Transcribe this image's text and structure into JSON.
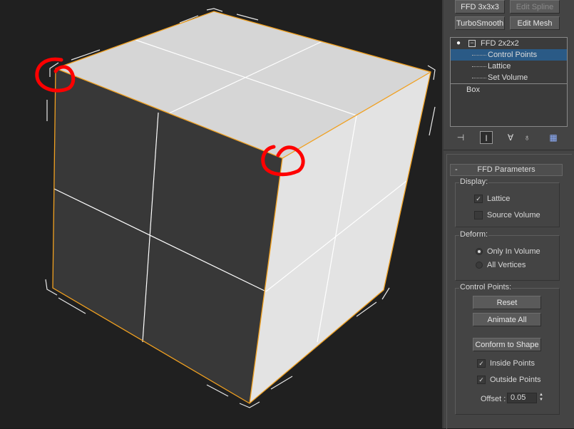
{
  "modifier_buttons": {
    "ffd333": "FFD 3x3x3",
    "edit_spline": "Edit Spline",
    "turbosmooth": "TurboSmooth",
    "edit_mesh": "Edit Mesh"
  },
  "modifier_stack": {
    "root": "FFD 2x2x2",
    "children": [
      "Control Points",
      "Lattice",
      "Set Volume"
    ],
    "base": "Box",
    "selected": "Control Points"
  },
  "rollout": {
    "collapse_symbol": "-",
    "title": "FFD Parameters",
    "display": {
      "label": "Display:",
      "lattice": {
        "label": "Lattice",
        "checked": true
      },
      "source_volume": {
        "label": "Source Volume",
        "checked": false
      }
    },
    "deform": {
      "label": "Deform:",
      "options": [
        "Only In Volume",
        "All Vertices"
      ],
      "selected": "Only In Volume"
    },
    "control_points": {
      "label": "Control Points:",
      "reset": "Reset",
      "animate_all": "Animate All",
      "conform": "Conform to Shape",
      "inside_points": {
        "label": "Inside Points",
        "checked": true
      },
      "outside_points": {
        "label": "Outside Points",
        "checked": true
      },
      "offset_label": "Offset :",
      "offset_value": "0.05"
    }
  },
  "colors": {
    "viewport_bg": "#202020",
    "selection_orange": "#f0a020",
    "annotation_red": "#ff0000",
    "stack_highlight": "#2a5a86"
  },
  "icons": [
    "pin-stack-icon",
    "show-end-result-icon",
    "make-unique-icon",
    "remove-modifier-icon",
    "configure-modifier-sets-icon"
  ]
}
